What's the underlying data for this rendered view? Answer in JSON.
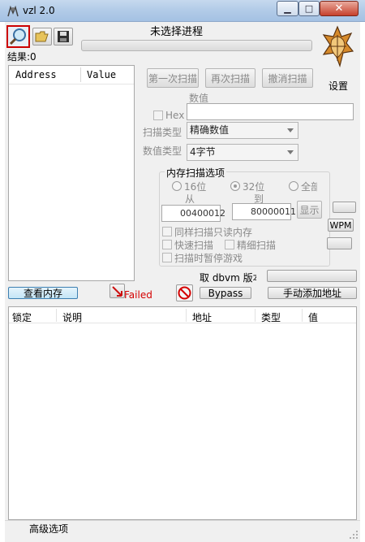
{
  "window": {
    "title": "vzl 2.0",
    "minimize_glyph": "▁",
    "maximize_glyph": "□",
    "close_glyph": "✕"
  },
  "toolbar": {
    "search_icon": "magnifier-icon",
    "open_icon": "folder-open-icon",
    "save_icon": "floppy-disk-icon"
  },
  "process": {
    "label": "未选择进程"
  },
  "results": {
    "label": "结果:0",
    "columns": [
      "Address",
      "Value"
    ]
  },
  "scan_buttons": {
    "first_scan": "第一次扫描",
    "next_scan": "再次扫描",
    "undo_scan": "撤消扫描"
  },
  "settings": {
    "label": "设置"
  },
  "value": {
    "label": "数值",
    "hex_label": "Hex",
    "input_value": ""
  },
  "scan_type": {
    "label": "扫描类型",
    "selected": "精确数值"
  },
  "value_type": {
    "label": "数值类型",
    "selected": "4字节"
  },
  "memory_options": {
    "title": "内存扫描选项",
    "radio_16": "16位",
    "radio_32": "32位",
    "radio_all": "全部",
    "from_label": "从",
    "to_label": "到",
    "from_value": "00400012",
    "to_value": "80000011",
    "show_button": "显示",
    "checkbox_readonly": "同样扫描只读内存",
    "checkbox_fast": "快速扫描",
    "checkbox_precise": "精细扫描",
    "checkbox_pause": "扫描时暂停游戏"
  },
  "side_buttons": {
    "wpm": "WPM"
  },
  "dbvm": {
    "label": "取 dbvm 版本"
  },
  "bottom_bar": {
    "view_memory": "查看内存",
    "failed": "Failed",
    "bypass": "Bypass",
    "manual_add": "手动添加地址"
  },
  "address_list": {
    "columns": [
      "锁定",
      "说明",
      "地址",
      "类型",
      "值"
    ]
  },
  "footer": {
    "advanced": "高级选项"
  },
  "colors": {
    "failed_text": "#d40000",
    "selected_tool_border": "#cc0000"
  }
}
